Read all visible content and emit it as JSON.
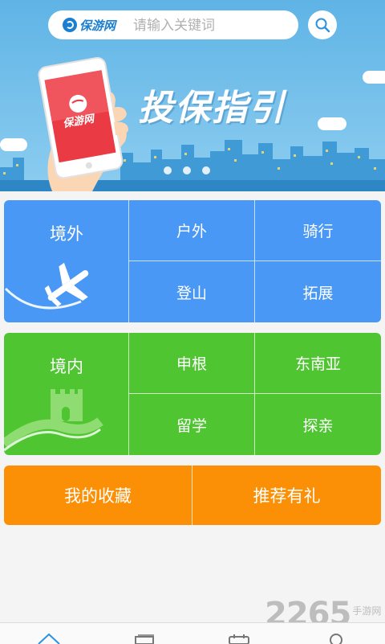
{
  "search": {
    "logo_text": "保游网",
    "placeholder": "请输入关键词"
  },
  "banner": {
    "title": "投保指引",
    "phone_logo_text": "保游网",
    "slide_count": 3
  },
  "overseas": {
    "label": "境外",
    "items": [
      "户外",
      "骑行",
      "登山",
      "拓展"
    ],
    "color": "#4a98f5"
  },
  "domestic": {
    "label": "境内",
    "items": [
      "申根",
      "东南亚",
      "留学",
      "探亲"
    ],
    "color": "#50c532"
  },
  "actions": {
    "favorites": "我的收藏",
    "referral": "推荐有礼",
    "color": "#fb9006"
  },
  "watermark": {
    "number": "2265",
    "suffix": "手游网"
  },
  "bottom_nav": {
    "icons": [
      "home-icon",
      "list-icon",
      "calendar-icon",
      "user-icon"
    ]
  }
}
